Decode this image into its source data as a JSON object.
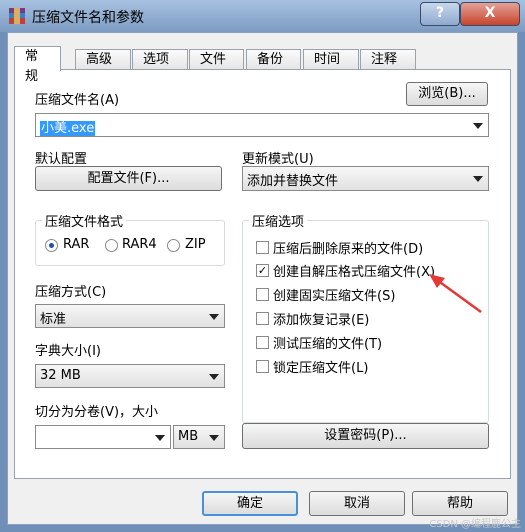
{
  "window": {
    "title": "压缩文件名和参数",
    "help_label": "?",
    "close_label": "X"
  },
  "tabs": [
    {
      "label": "常规"
    },
    {
      "label": "高级"
    },
    {
      "label": "选项"
    },
    {
      "label": "文件"
    },
    {
      "label": "备份"
    },
    {
      "label": "时间"
    },
    {
      "label": "注释"
    }
  ],
  "general": {
    "archive_name_label": "压缩文件名(A)",
    "browse_label": "浏览(B)...",
    "archive_name_value": "小美.exe",
    "default_config_label": "默认配置",
    "config_button_label": "配置文件(F)...",
    "update_mode_label": "更新模式(U)",
    "update_mode_value": "添加并替换文件",
    "format_group_title": "压缩文件格式",
    "format_options": [
      {
        "label": "RAR",
        "checked": true
      },
      {
        "label": "RAR4",
        "checked": false
      },
      {
        "label": "ZIP",
        "checked": false
      }
    ],
    "options_group_title": "压缩选项",
    "options": [
      {
        "label": "压缩后删除原来的文件(D)",
        "checked": false
      },
      {
        "label": "创建自解压格式压缩文件(X)",
        "checked": true
      },
      {
        "label": "创建固实压缩文件(S)",
        "checked": false
      },
      {
        "label": "添加恢复记录(E)",
        "checked": false
      },
      {
        "label": "测试压缩的文件(T)",
        "checked": false
      },
      {
        "label": "锁定压缩文件(L)",
        "checked": false
      }
    ],
    "method_label": "压缩方式(C)",
    "method_value": "标准",
    "dict_label": "字典大小(I)",
    "dict_value": "32 MB",
    "split_label": "切分为分卷(V)，大小",
    "split_value": "",
    "split_unit": "MB",
    "password_button_label": "设置密码(P)..."
  },
  "footer": {
    "ok_label": "确定",
    "cancel_label": "取消",
    "help_label": "帮助"
  },
  "watermark": "CSDN @编程鹿公主"
}
